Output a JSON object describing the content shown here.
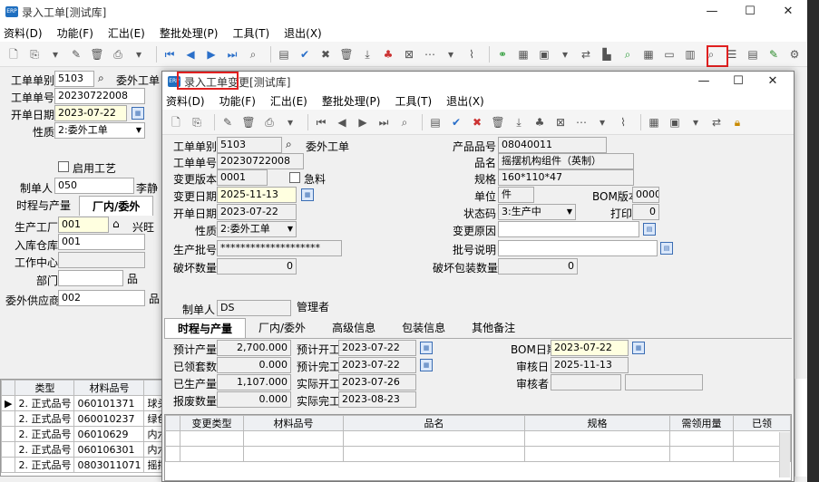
{
  "main": {
    "title": "录入工单[测试库]",
    "menu": [
      "资料(D)",
      "功能(F)",
      "汇出(E)",
      "整批处理(P)",
      "工具(T)",
      "退出(X)"
    ],
    "fields": {
      "order_type_label": "工单单别",
      "order_type": "5103",
      "order_type_name": "委外工单",
      "order_no_label": "工单单号",
      "order_no": "20230722008",
      "start_date_label": "开单日期",
      "start_date": "2023-07-22",
      "nature_label": "性质",
      "nature": "2:委外工单",
      "enable_process_label": "启用工艺",
      "creator_label": "制单人",
      "creator": "050",
      "creator_name": "李静"
    },
    "tabs": [
      "时程与产量",
      "厂内/委外"
    ],
    "production": {
      "factory_label": "生产工厂",
      "factory": "001",
      "factory_name": "兴旺",
      "warehouse_label": "入库仓库",
      "warehouse": "001",
      "workcenter_label": "工作中心",
      "dept_label": "部门",
      "supplier_label": "委外供应商",
      "supplier": "002"
    },
    "grid": {
      "headers": [
        "类型",
        "材料品号",
        ""
      ],
      "rows": [
        [
          "2. 正式品号",
          "060101371",
          "球头"
        ],
        [
          "2. 正式品号",
          "060010237",
          "绿色"
        ],
        [
          "2. 正式品号",
          "06010629",
          "内六"
        ],
        [
          "2. 正式品号",
          "060106301",
          "内六"
        ],
        [
          "2. 正式品号",
          "0803011071",
          "摇摆"
        ]
      ]
    }
  },
  "dialog": {
    "title": "录入工单变更",
    "title_suffix": "[测试库]",
    "menu": [
      "资料(D)",
      "功能(F)",
      "汇出(E)",
      "整批处理(P)",
      "工具(T)",
      "退出(X)"
    ],
    "left": {
      "order_type_label": "工单单别",
      "order_type": "5103",
      "order_type_name": "委外工单",
      "order_no_label": "工单单号",
      "order_no": "20230722008",
      "version_label": "变更版本",
      "version": "0001",
      "urgent_label": "急料",
      "change_date_label": "变更日期",
      "change_date": "2025-11-13",
      "start_date_label": "开单日期",
      "start_date": "2023-07-22",
      "nature_label": "性质",
      "nature": "2:委外工单",
      "batch_label": "生产批号",
      "batch": "********************",
      "broken_label": "破坏数量",
      "broken": "0"
    },
    "right": {
      "product_no_label": "产品品号",
      "product_no": "08040011",
      "name_label": "品名",
      "name": "摇摆机构组件（英制）",
      "spec_label": "规格",
      "spec": "160*110*47",
      "unit_label": "单位",
      "unit": "件",
      "bom_version_label": "BOM版本",
      "bom_version": "0000",
      "status_label": "状态码",
      "status": "3:生产中",
      "print_label": "打印",
      "print": "0",
      "reason_label": "变更原因",
      "batch_desc_label": "批号说明",
      "broken_pack_label": "破坏包装数量",
      "broken_pack": "0"
    },
    "creator_label": "制单人",
    "creator": "DS",
    "creator_name": "管理者",
    "tabs": [
      "时程与产量",
      "厂内/委外",
      "高级信息",
      "包装信息",
      "其他备注"
    ],
    "schedule": {
      "plan_qty_label": "预计产量",
      "plan_qty": "2,700.000",
      "issued_label": "已领套数",
      "issued": "0.000",
      "produced_label": "已生产量",
      "produced": "1,107.000",
      "scrap_label": "报废数量",
      "scrap": "0.000",
      "plan_start_label": "预计开工",
      "plan_start": "2023-07-22",
      "plan_end_label": "预计完工",
      "plan_end": "2023-07-22",
      "actual_start_label": "实际开工",
      "actual_start": "2023-07-26",
      "actual_end_label": "实际完工",
      "actual_end": "2023-08-23",
      "bom_date_label": "BOM日期",
      "bom_date": "2023-07-22",
      "audit_date_label": "审核日",
      "audit_date": "2025-11-13",
      "auditor_label": "审核者"
    },
    "grid_headers": [
      "变更类型",
      "材料品号",
      "品名",
      "规格",
      "需领用量",
      "已领"
    ]
  }
}
